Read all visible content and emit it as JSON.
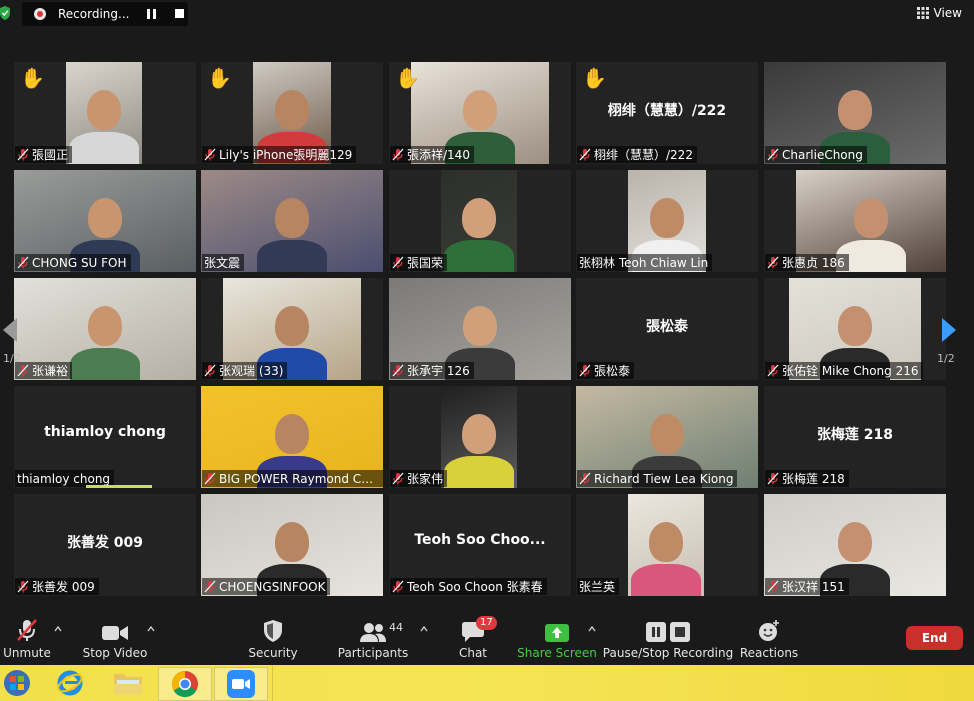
{
  "recording": {
    "label": "Recording..."
  },
  "view": {
    "label": "View"
  },
  "gallery": {
    "page_left": "1/2",
    "page_right": "1/2",
    "tiles": [
      {
        "name": "張國正",
        "hand": true,
        "mode": "video"
      },
      {
        "name": "Lily's iPhone張明麗129",
        "hand": true,
        "mode": "video"
      },
      {
        "name": "張添祥/140",
        "hand": true,
        "mode": "video"
      },
      {
        "name": "栩绯（慧慧）/222",
        "hand": true,
        "mode": "text",
        "center": "栩绯（慧慧）/222"
      },
      {
        "name": "CharlieChong",
        "hand": false,
        "mode": "video"
      },
      {
        "name": "CHONG SU FOH",
        "hand": false,
        "mode": "video"
      },
      {
        "name": "张文震",
        "hand": false,
        "mode": "video",
        "active": true,
        "nomic": true
      },
      {
        "name": "張国荣",
        "hand": false,
        "mode": "video"
      },
      {
        "name": "张栩林 Teoh Chiaw Lin",
        "hand": false,
        "mode": "video",
        "nomic": true
      },
      {
        "name": "张惠贞 186",
        "hand": false,
        "mode": "video"
      },
      {
        "name": "张谦裕",
        "hand": false,
        "mode": "video"
      },
      {
        "name": "张观瑞 (33)",
        "hand": false,
        "mode": "video"
      },
      {
        "name": "张承宇 126",
        "hand": false,
        "mode": "video"
      },
      {
        "name": "張松泰",
        "hand": false,
        "mode": "text",
        "center": "張松泰"
      },
      {
        "name": "张佑铨 Mike Chong 216",
        "hand": false,
        "mode": "video"
      },
      {
        "name": "thiamloy chong",
        "hand": false,
        "mode": "text",
        "center": "thiamloy chong",
        "nomic": true,
        "speaking": true
      },
      {
        "name": "BIG POWER Raymond CHO...",
        "hand": false,
        "mode": "video"
      },
      {
        "name": "张家伟",
        "hand": false,
        "mode": "video"
      },
      {
        "name": "Richard Tiew Lea Kiong",
        "hand": false,
        "mode": "video"
      },
      {
        "name": "张梅莲 218",
        "hand": false,
        "mode": "text",
        "center": "张梅莲 218"
      },
      {
        "name": "张善发 009",
        "hand": false,
        "mode": "text",
        "center": "张善发 009"
      },
      {
        "name": "CHOENGSINFOOK",
        "hand": false,
        "mode": "video"
      },
      {
        "name": "Teoh Soo Choon 张素春",
        "hand": false,
        "mode": "text",
        "center": "Teoh Soo Choo..."
      },
      {
        "name": "张兰英",
        "hand": false,
        "mode": "video",
        "nomic": true
      },
      {
        "name": "张汉祥 151",
        "hand": false,
        "mode": "video"
      }
    ]
  },
  "toolbar": {
    "unmute": "Unmute",
    "stop_video": "Stop Video",
    "security": "Security",
    "participants": "Participants",
    "participants_count": "44",
    "chat": "Chat",
    "chat_badge": "17",
    "share_screen": "Share Screen",
    "pause_stop_recording": "Pause/Stop Recording",
    "reactions": "Reactions",
    "end": "End"
  },
  "colors": {
    "active_speaker": "#c8e24a",
    "end_button": "#c9302c",
    "share_green": "#3fbf3f",
    "muted_red": "#e0383e"
  }
}
